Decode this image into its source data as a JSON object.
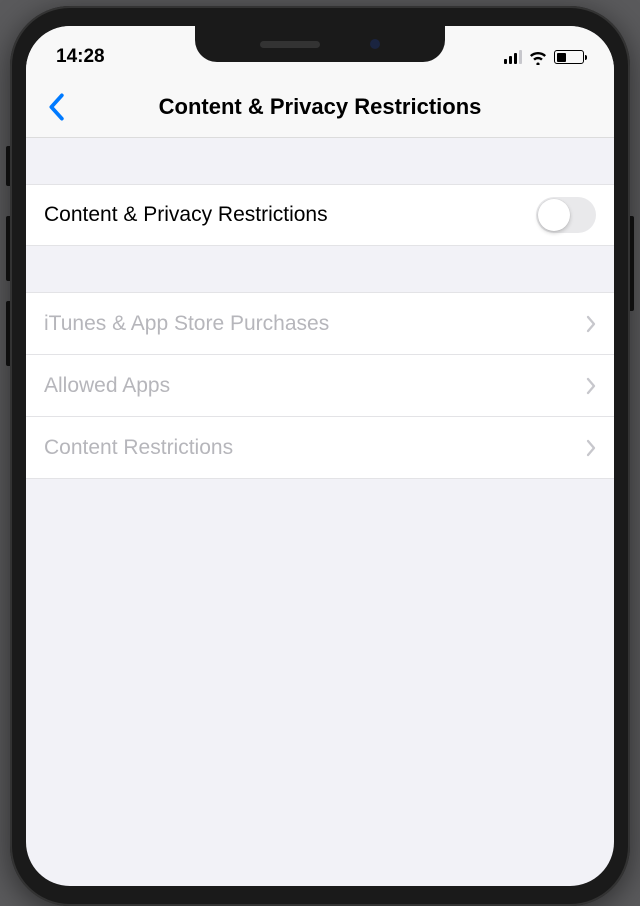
{
  "status_bar": {
    "time": "14:28"
  },
  "nav": {
    "title": "Content & Privacy Restrictions"
  },
  "toggle_row": {
    "label": "Content & Privacy Restrictions",
    "on": false
  },
  "rows": [
    {
      "label": "iTunes & App Store Purchases"
    },
    {
      "label": "Allowed Apps"
    },
    {
      "label": "Content Restrictions"
    }
  ]
}
